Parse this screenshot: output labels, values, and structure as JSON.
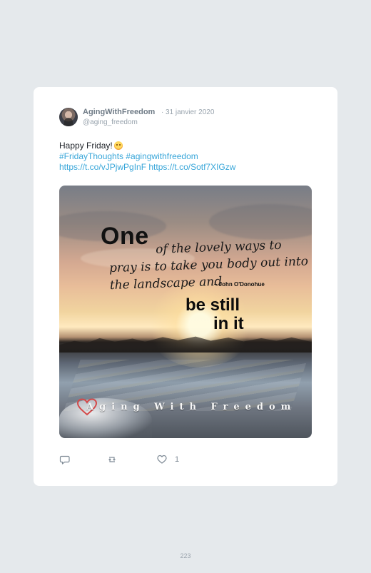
{
  "tweet": {
    "author_name": "AgingWithFreedom",
    "separator": "·",
    "date": "31 janvier 2020",
    "handle": "@aging_freedom",
    "text_line_1": "Happy Friday!",
    "emoji_name": "smiling-face-icon",
    "hashtags": "#FridayThoughts #agingwithfreedom",
    "links": "https://t.co/vJPjwPgInF https://t.co/Sotf7XIGzw",
    "image": {
      "quote_one": "One",
      "quote_line_1": "of the lovely ways to",
      "quote_line_2": "pray is to take you body out into",
      "quote_line_3": "the landscape and",
      "author": "– John O'Donohue",
      "emphasis_line_1": "be still",
      "emphasis_line_2": "in it",
      "watermark": "Aging With Freedom"
    },
    "actions": {
      "reply_icon": "reply-icon",
      "retweet_icon": "retweet-icon",
      "like_icon": "heart-icon",
      "like_count": "1"
    }
  },
  "page": {
    "number": "223"
  },
  "colors": {
    "background": "#e5e9ec",
    "card": "#ffffff",
    "link": "#38a6d9",
    "meta": "#98a3ad",
    "heart": "#d44a4a"
  }
}
